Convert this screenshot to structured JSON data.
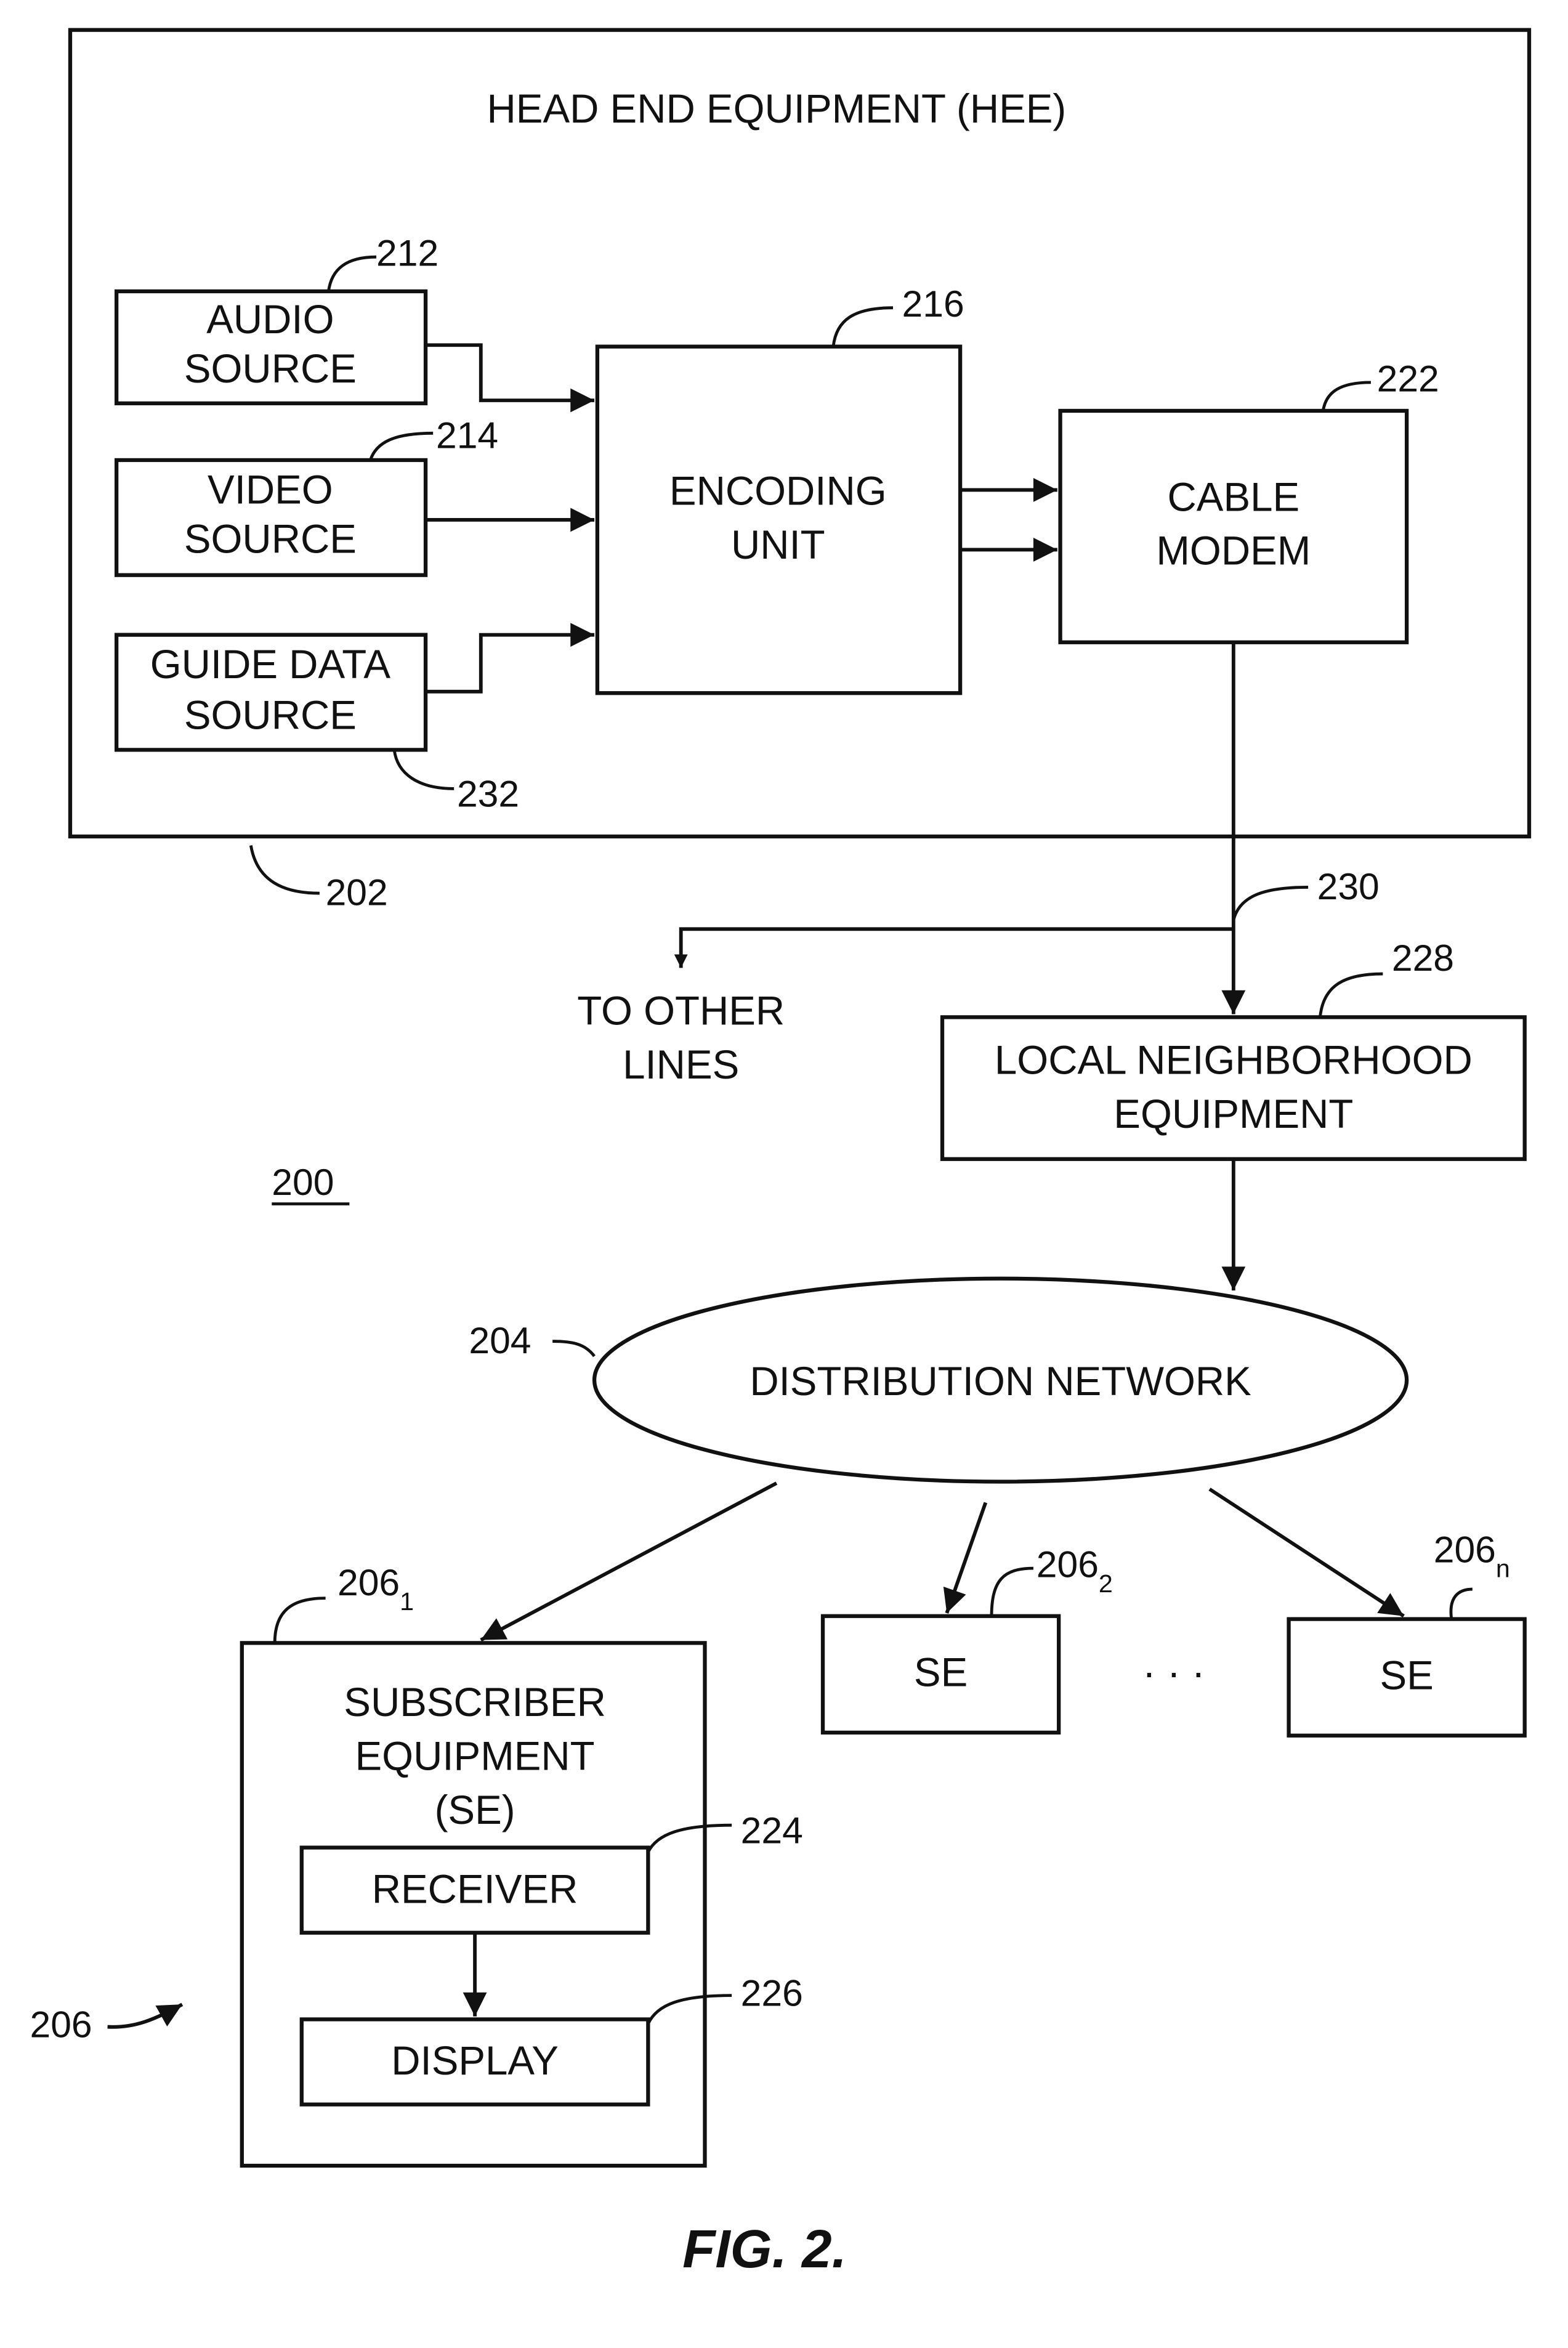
{
  "figure": {
    "caption": "FIG. 2.",
    "system_ref": "200",
    "head_end": {
      "title": "HEAD END EQUIPMENT (HEE)",
      "ref": "202"
    },
    "blocks": {
      "audio_source": {
        "line1": "AUDIO",
        "line2": "SOURCE",
        "ref": "212"
      },
      "video_source": {
        "line1": "VIDEO",
        "line2": "SOURCE",
        "ref": "214"
      },
      "guide_data_source": {
        "line1": "GUIDE DATA",
        "line2": "SOURCE",
        "ref": "232"
      },
      "encoding_unit": {
        "line1": "ENCODING",
        "line2": "UNIT",
        "ref": "216"
      },
      "cable_modem": {
        "line1": "CABLE",
        "line2": "MODEM",
        "ref": "222"
      },
      "local_neighborhood": {
        "line1": "LOCAL NEIGHBORHOOD",
        "line2": "EQUIPMENT",
        "ref": "228"
      },
      "distribution_network": {
        "label": "DISTRIBUTION NETWORK",
        "ref": "204"
      },
      "subscriber_equipment": {
        "line1": "SUBSCRIBER",
        "line2": "EQUIPMENT",
        "line3": "(SE)",
        "ref": "206",
        "ref_sub": "1"
      },
      "receiver": {
        "label": "RECEIVER",
        "ref": "224"
      },
      "display": {
        "label": "DISPLAY",
        "ref": "226"
      },
      "se_2": {
        "label": "SE",
        "ref": "206",
        "ref_sub": "2"
      },
      "se_n": {
        "label": "SE",
        "ref": "206",
        "ref_sub": "n"
      }
    },
    "line_230": {
      "ref": "230"
    },
    "to_other_lines": {
      "line1": "TO OTHER",
      "line2": "LINES"
    },
    "ellipsis": "· · ·",
    "subscriber_group_ref": "206"
  }
}
